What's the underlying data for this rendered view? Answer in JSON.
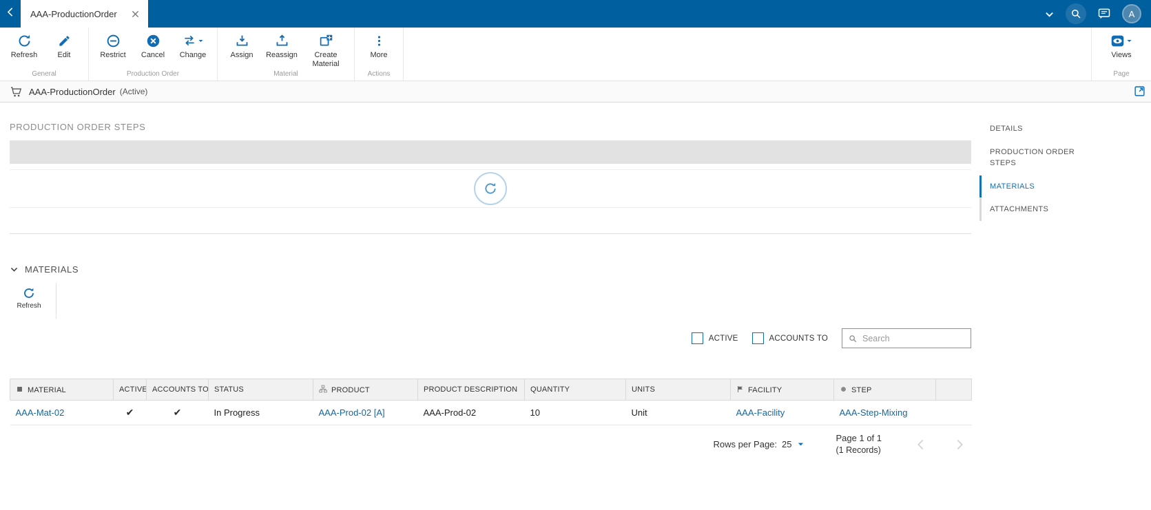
{
  "topbar": {
    "tab_title": "AAA-ProductionOrder",
    "avatar_letter": "A"
  },
  "toolbar": {
    "groups": [
      {
        "label": "General",
        "buttons": [
          {
            "label": "Refresh"
          },
          {
            "label": "Edit"
          }
        ]
      },
      {
        "label": "Production Order",
        "buttons": [
          {
            "label": "Restrict"
          },
          {
            "label": "Cancel"
          },
          {
            "label": "Change"
          }
        ]
      },
      {
        "label": "Material",
        "buttons": [
          {
            "label": "Assign"
          },
          {
            "label": "Reassign"
          },
          {
            "label": "Create Material"
          }
        ]
      },
      {
        "label": "Actions",
        "buttons": [
          {
            "label": "More"
          }
        ]
      }
    ],
    "page_group": {
      "label": "Page",
      "views_label": "Views"
    }
  },
  "record_header": {
    "title": "AAA-ProductionOrder",
    "status": "(Active)"
  },
  "steps_section": {
    "heading": "PRODUCTION ORDER STEPS"
  },
  "materials_section": {
    "heading": "MATERIALS",
    "refresh_label": "Refresh",
    "filters": {
      "active_label": "ACTIVE",
      "accounts_to_label": "ACCOUNTS TO",
      "search_placeholder": "Search"
    },
    "table": {
      "columns": [
        "MATERIAL",
        "ACTIVE",
        "ACCOUNTS TO",
        "STATUS",
        "PRODUCT",
        "PRODUCT DESCRIPTION",
        "QUANTITY",
        "UNITS",
        "FACILITY",
        "STEP"
      ],
      "rows": [
        {
          "material": "AAA-Mat-02",
          "active": "✔",
          "accounts_to": "✔",
          "status": "In Progress",
          "product": "AAA-Prod-02 [A]",
          "product_description": "AAA-Prod-02",
          "quantity": "10",
          "units": "Unit",
          "facility": "AAA-Facility",
          "step": "AAA-Step-Mixing"
        }
      ]
    },
    "pagination": {
      "rows_per_page_label": "Rows per Page:",
      "rows_per_page_value": "25",
      "page_info": "Page 1 of 1",
      "records_info": "(1 Records)"
    }
  },
  "anchor_nav": {
    "items": [
      {
        "label": "DETAILS"
      },
      {
        "label": "PRODUCTION ORDER STEPS"
      },
      {
        "label": "MATERIALS"
      },
      {
        "label": "ATTACHMENTS"
      }
    ],
    "active": "MATERIALS"
  },
  "icons": {
    "back": "chevron-left",
    "tab_close": "x",
    "topbar_dropdown": "chevron-down",
    "search": "magnifier",
    "chat": "speech-bubble",
    "avatar": "user-initial",
    "refresh": "circular-arrow",
    "edit": "pencil",
    "restrict": "no-entry-circle",
    "cancel": "x-circle",
    "change": "swap-arrows",
    "assign": "arrow-down-tray",
    "reassign": "arrow-up-tray",
    "create_material": "plus-square",
    "more": "ellipsis-vertical",
    "views": "eye",
    "record": "shopping-cart",
    "expand": "open-in-window",
    "materials_collapse": "chevron-down",
    "check": "✔",
    "material_col": "square",
    "product_col": "hierarchy",
    "facility_col": "flag",
    "step_col": "circle",
    "spinner": "circular-arrow"
  },
  "colors": {
    "topbar_bg": "#005f9e",
    "accent": "#0f6cb5",
    "link": "#15689f"
  }
}
